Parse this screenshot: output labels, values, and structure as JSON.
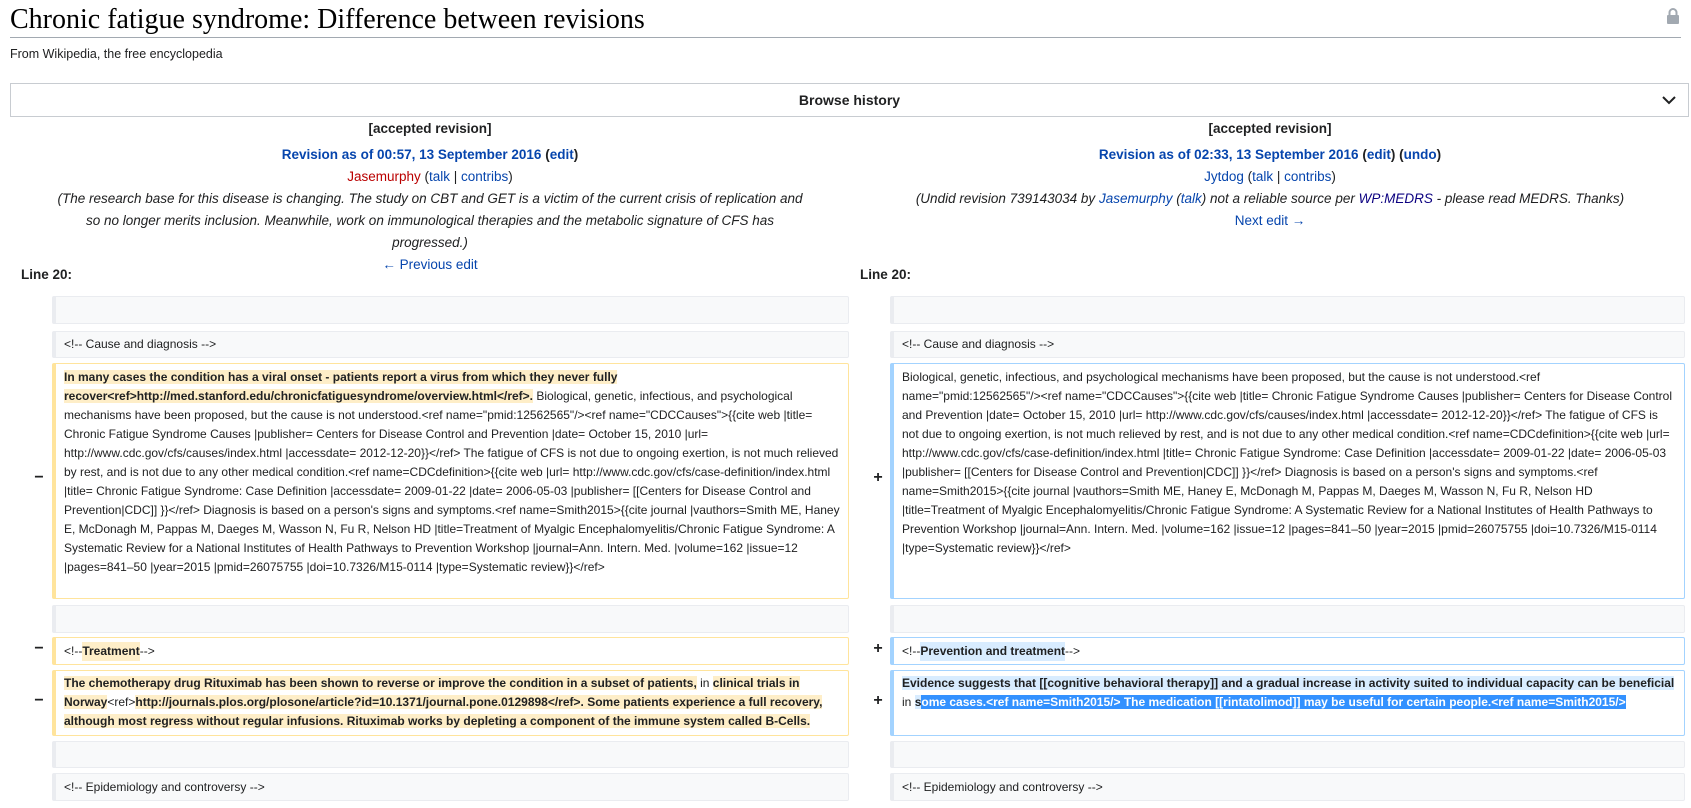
{
  "page": {
    "title": "Chronic fatigue syndrome: Difference between revisions",
    "tagline": "From Wikipedia, the free encyclopedia",
    "browse_history": "Browse history"
  },
  "left": {
    "accepted": "[accepted revision]",
    "revision": "Revision as of 00:57, 13 September 2016",
    "edit": "edit",
    "user": "Jasemurphy",
    "talk": "talk",
    "contribs": "contribs",
    "summary": "(The research base for this disease is changing. The study on CBT and GET is a victim of the current crisis of replication and so no longer merits inclusion. Meanwhile, work on immunological therapies and the metabolic signature of CFS has progressed.)",
    "nav": "← Previous edit",
    "line": "Line 20:"
  },
  "right": {
    "accepted": "[accepted revision]",
    "revision": "Revision as of 02:33, 13 September 2016",
    "edit": "edit",
    "undo": "undo",
    "user": "Jytdog",
    "talk": "talk",
    "contribs": "contribs",
    "summary_pre": "(Undid revision 739143034 by ",
    "summary_user": "Jasemurphy",
    "summary_talk": "talk",
    "summary_mid": ") not a reliable source per ",
    "summary_link": "WP:MEDRS",
    "summary_post": " - please read MEDRS. Thanks)",
    "nav": "Next edit →",
    "line": "Line 20:"
  },
  "diff": {
    "minus": "−",
    "plus": "+",
    "ctx_cause": "<!-- Cause and diagnosis -->",
    "ctx_epi": "<!-- Epidemiology and controversy -->",
    "left_block1_hl": "In many cases the condition has a viral onset - patients report a virus from which they never fully recover<ref>http://med.stanford.edu/chronicfatiguesyndrome/overview.html</ref>.",
    "left_block1_rest": " Biological, genetic, infectious, and psychological mechanisms have been proposed, but the cause is not understood.<ref name=\"pmid:12562565\"/><ref name=\"CDCCauses\">{{cite web |title= Chronic Fatigue Syndrome Causes |publisher= Centers for Disease Control and Prevention |date= October 15, 2010 |url= http://www.cdc.gov/cfs/causes/index.html |accessdate= 2012-12-20}}</ref> The fatigue of CFS is not due to ongoing exertion, is not much relieved by rest, and is not due to any other medical condition.<ref name=CDCdefinition>{{cite web |url= http://www.cdc.gov/cfs/case-definition/index.html |title= Chronic Fatigue Syndrome: Case Definition |accessdate= 2009-01-22 |date= 2006-05-03 |publisher= [[Centers for Disease Control and Prevention|CDC]] }}</ref> Diagnosis is based on a person's signs and symptoms.<ref name=Smith2015>{{cite journal |vauthors=Smith ME, Haney E, McDonagh M, Pappas M, Daeges M, Wasson N, Fu R, Nelson HD |title=Treatment of Myalgic Encephalomyelitis/Chronic Fatigue Syndrome: A Systematic Review for a National Institutes of Health Pathways to Prevention Workshop |journal=Ann. Intern. Med. |volume=162 |issue=12 |pages=841–50 |year=2015 |pmid=26075755 |doi=10.7326/M15-0114 |type=Systematic review}}</ref>",
    "right_block1": "Biological, genetic, infectious, and psychological mechanisms have been proposed, but the cause is not understood.<ref name=\"pmid:12562565\"/><ref name=\"CDCCauses\">{{cite web |title= Chronic Fatigue Syndrome Causes |publisher= Centers for Disease Control and Prevention |date= October 15, 2010 |url= http://www.cdc.gov/cfs/causes/index.html |accessdate= 2012-12-20}}</ref> The fatigue of CFS is not due to ongoing exertion, is not much relieved by rest, and is not due to any other medical condition.<ref name=CDCdefinition>{{cite web |url= http://www.cdc.gov/cfs/case-definition/index.html |title= Chronic Fatigue Syndrome: Case Definition |accessdate= 2009-01-22 |date= 2006-05-03 |publisher= [[Centers for Disease Control and Prevention|CDC]] }}</ref> Diagnosis is based on a person's signs and symptoms.<ref name=Smith2015>{{cite journal |vauthors=Smith ME, Haney E, McDonagh M, Pappas M, Daeges M, Wasson N, Fu R, Nelson HD |title=Treatment of Myalgic Encephalomyelitis/Chronic Fatigue Syndrome: A Systematic Review for a National Institutes of Health Pathways to Prevention Workshop |journal=Ann. Intern. Med. |volume=162 |issue=12 |pages=841–50 |year=2015 |pmid=26075755 |doi=10.7326/M15-0114 |type=Systematic review}}</ref>",
    "left_treat_pre": "<!-- ",
    "left_treat_hl": "Treatment",
    "left_treat_post": " -->",
    "right_treat_pre": "<!-- ",
    "right_treat_hl": "Prevention and treatment",
    "right_treat_post": " -->",
    "left_block2_a": "The chemotherapy drug Rituximab has been shown to reverse or improve the condition in a subset of patients,",
    "left_block2_b": " in ",
    "left_block2_c": "clinical trials in Norway",
    "left_block2_d": "<ref>",
    "left_block2_e": "http://journals.plos.org/plosone/article?id=10.1371/journal.pone.0129898</ref>. Some patients experience a full recovery, although most regress without regular infusions. Rituximab works by depleting a component of the immune system called B-Cells.",
    "right_block2_a": "Evidence suggests that [[cognitive behavioral therapy]] and a gradual increase in activity suited to individual capacity can be beneficial",
    "right_block2_b": " in ",
    "right_block2_c": "s",
    "right_block2_sel": "ome cases.<ref name=Smith2015/> The medication [[rintatolimod]] may be useful for certain people.<ref name=Smith2015/>"
  },
  "colors": {
    "link": "#0645ad",
    "deleted_border": "#ffe49c",
    "added_border": "#a3d3ff",
    "selection": "#3391ff"
  }
}
